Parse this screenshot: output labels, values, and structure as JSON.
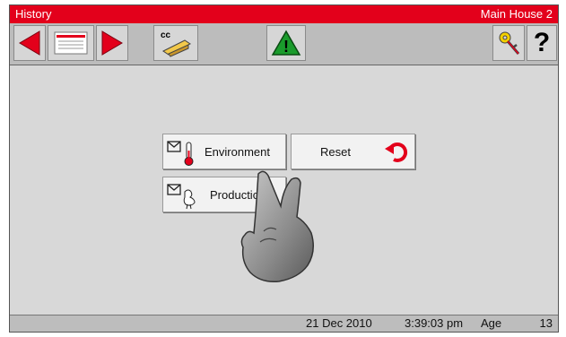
{
  "titlebar": {
    "left": "History",
    "right": "Main House 2"
  },
  "toolbar": {
    "buttons": [
      {
        "icon": "arrow-left-icon"
      },
      {
        "icon": "report-card-icon"
      },
      {
        "icon": "arrow-right-icon"
      },
      {
        "icon": "cc-wrench-icon",
        "text": "cc"
      },
      {
        "icon": "warning-icon",
        "text": "!"
      },
      {
        "icon": "key-icon"
      },
      {
        "icon": "help-icon",
        "text": "?"
      }
    ]
  },
  "menu": {
    "environment_label": "Environment",
    "reset_label": "Reset",
    "production_label": "Productic"
  },
  "status": {
    "date": "21 Dec 2010",
    "time": "3:39:03 pm",
    "age_label": "Age",
    "age_value": "13"
  },
  "colors": {
    "titlebar": "#e3001b",
    "arrow": "#e3001b",
    "warning": "#1a9b2c"
  }
}
